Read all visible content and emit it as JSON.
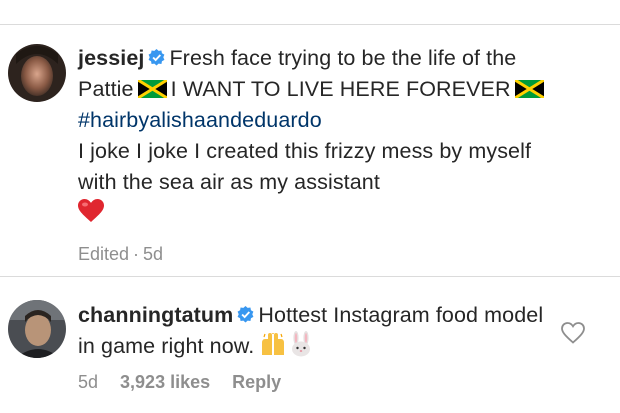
{
  "comments": [
    {
      "username": "jessiej",
      "text_parts": {
        "p1": "Fresh face trying to be the life of the Pattie",
        "p2": "I WANT TO LIVE HERE FOREVER",
        "hashtag": "#hairbyalishaandeduardo",
        "p3": "I joke I joke I created this frizzy mess by myself with the sea air as my assistant"
      },
      "emoji_icons": [
        "jamaica-flag-icon",
        "jamaica-flag-icon",
        "red-heart-icon"
      ],
      "edited_label": "Edited",
      "separator": "·",
      "time": "5d"
    },
    {
      "username": "channingtatum",
      "text": "Hottest Instagram food model in game right now.",
      "emoji_icons": [
        "raised-hands-icon",
        "bunny-icon"
      ],
      "time": "5d",
      "likes": "3,923 likes",
      "reply_label": "Reply",
      "like_icon": "heart-outline-icon"
    }
  ],
  "colors": {
    "text": "#262626",
    "hashtag": "#003569",
    "meta": "#8e8e8e",
    "verified": "#3897f0",
    "heart": "#ed4956",
    "divider": "#dbdbdb"
  }
}
